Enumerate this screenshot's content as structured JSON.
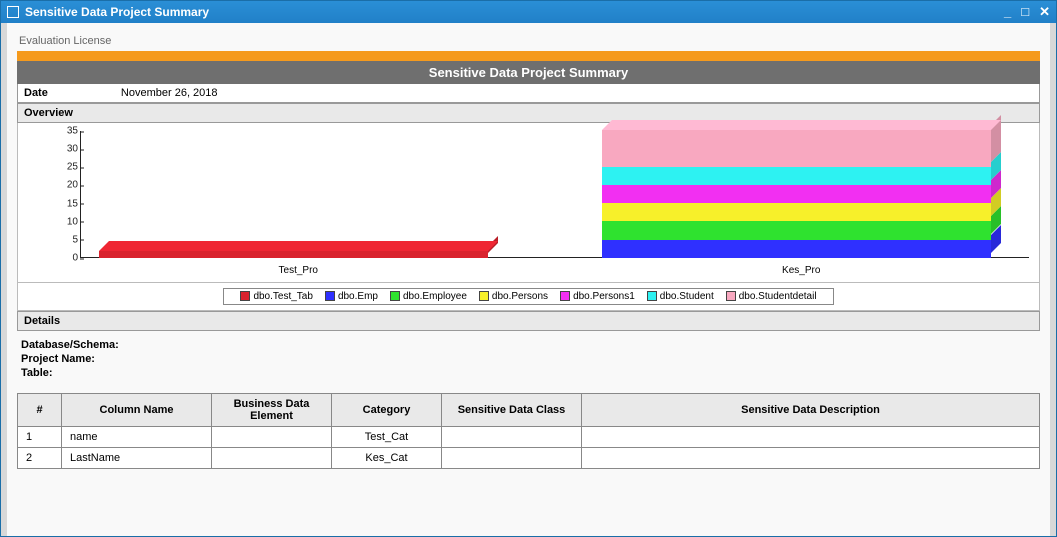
{
  "window": {
    "title": "Sensitive Data Project Summary"
  },
  "license_text": "Evaluation License",
  "banner_title": "Sensitive Data Project Summary",
  "date_label": "Date",
  "date_value": "November 26, 2018",
  "overview_label": "Overview",
  "details_label": "Details",
  "detail_fields": {
    "db_schema": "Database/Schema:",
    "project": "Project Name:",
    "table": "Table:"
  },
  "legend": [
    {
      "label": "dbo.Test_Tab",
      "color": "#d9232e"
    },
    {
      "label": "dbo.Emp",
      "color": "#2f30ff"
    },
    {
      "label": "dbo.Employee",
      "color": "#2fe22f"
    },
    {
      "label": "dbo.Persons",
      "color": "#f7f02a"
    },
    {
      "label": "dbo.Persons1",
      "color": "#f22ff2"
    },
    {
      "label": "dbo.Student",
      "color": "#2df2f2"
    },
    {
      "label": "dbo.Studentdetail",
      "color": "#f8a8c0"
    }
  ],
  "table_headers": {
    "idx": "#",
    "col": "Column Name",
    "bde": "Business Data Element",
    "cat": "Category",
    "cls": "Sensitive Data Class",
    "desc": "Sensitive Data Description"
  },
  "table_rows": [
    {
      "idx": "1",
      "col": "name",
      "bde": "",
      "cat": "Test_Cat",
      "cls": "",
      "desc": ""
    },
    {
      "idx": "2",
      "col": "LastName",
      "bde": "",
      "cat": "Kes_Cat",
      "cls": "",
      "desc": ""
    }
  ],
  "chart_data": {
    "type": "bar",
    "categories": [
      "Test_Pro",
      "Kes_Pro"
    ],
    "ylim": [
      0,
      35
    ],
    "yticks": [
      0,
      5,
      10,
      15,
      20,
      25,
      30,
      35
    ],
    "series": [
      {
        "name": "dbo.Test_Tab",
        "color": "#d9232e",
        "values": [
          2,
          0
        ]
      },
      {
        "name": "dbo.Emp",
        "color": "#2f30ff",
        "values": [
          0,
          5
        ]
      },
      {
        "name": "dbo.Employee",
        "color": "#2fe22f",
        "values": [
          0,
          5
        ]
      },
      {
        "name": "dbo.Persons",
        "color": "#f7f02a",
        "values": [
          0,
          5
        ]
      },
      {
        "name": "dbo.Persons1",
        "color": "#f22ff2",
        "values": [
          0,
          5
        ]
      },
      {
        "name": "dbo.Student",
        "color": "#2df2f2",
        "values": [
          0,
          5
        ]
      },
      {
        "name": "dbo.Studentdetail",
        "color": "#f8a8c0",
        "values": [
          0,
          10
        ]
      }
    ]
  }
}
